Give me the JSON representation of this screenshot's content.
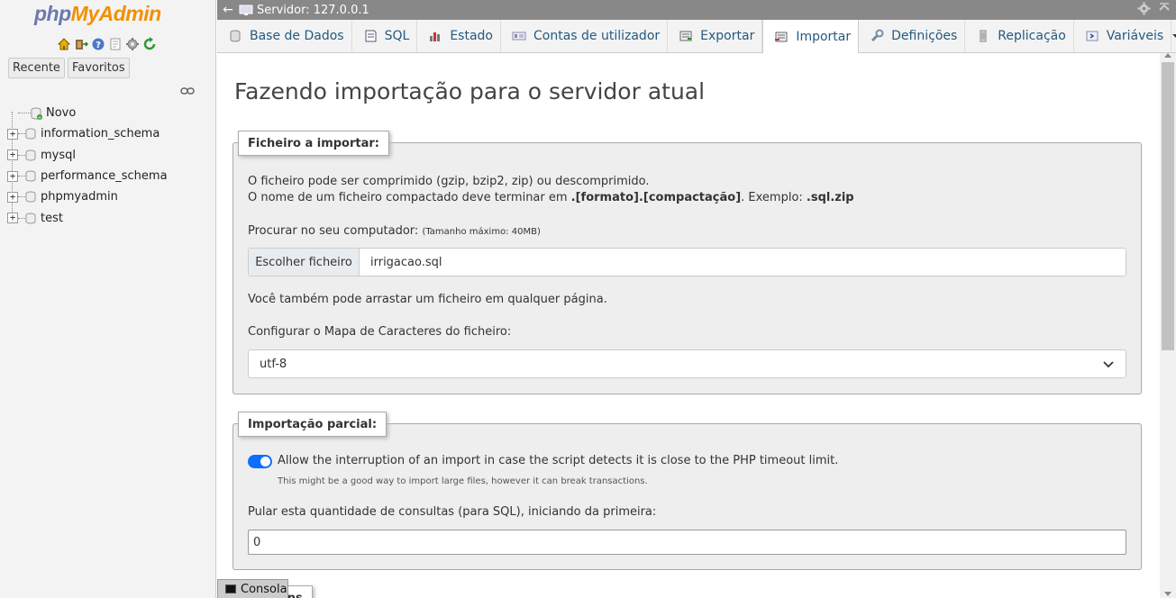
{
  "nav": {
    "logo_php": "php",
    "logo_myadmin": "MyAdmin",
    "quick_icons": [
      "home-icon",
      "exit-icon",
      "help-icon",
      "docs-icon",
      "settings-icon",
      "reload-icon"
    ],
    "tabs": [
      "Recente",
      "Favoritos"
    ],
    "tree": [
      {
        "label": "Novo",
        "icon": "new-database-icon"
      },
      {
        "label": "information_schema",
        "icon": "database-icon"
      },
      {
        "label": "mysql",
        "icon": "database-icon"
      },
      {
        "label": "performance_schema",
        "icon": "database-icon"
      },
      {
        "label": "phpmyadmin",
        "icon": "database-icon"
      },
      {
        "label": "test",
        "icon": "database-icon"
      }
    ]
  },
  "serverbar": {
    "back_arrow": "←",
    "server_label": "Servidor: 127.0.0.1"
  },
  "menu": {
    "tabs": [
      {
        "label": "Base de Dados",
        "icon": "database-icon"
      },
      {
        "label": "SQL",
        "icon": "sql-icon"
      },
      {
        "label": "Estado",
        "icon": "status-icon"
      },
      {
        "label": "Contas de utilizador",
        "icon": "users-icon"
      },
      {
        "label": "Exportar",
        "icon": "export-icon"
      },
      {
        "label": "Importar",
        "icon": "import-icon"
      },
      {
        "label": "Definições",
        "icon": "wrench-icon"
      },
      {
        "label": "Replicação",
        "icon": "replication-icon"
      },
      {
        "label": "Variáveis",
        "icon": "variables-icon"
      }
    ],
    "active": "Importar"
  },
  "main": {
    "title": "Fazendo importação para o servidor atual",
    "file_section": {
      "legend": "Ficheiro a importar:",
      "line1": "O ficheiro pode ser comprimido (gzip, bzip2, zip) ou descomprimido.",
      "line2_pre": "O nome de um ficheiro compactado deve terminar em ",
      "line2_bold": ".[formato].[compactação]",
      "line2_mid": ". Exemplo: ",
      "line2_example": ".sql.zip",
      "browse_label": "Procurar no seu computador:",
      "max_size": "(Tamanho máximo: 40MB)",
      "choose_button": "Escolher ficheiro",
      "file_name": "irrigacao.sql",
      "drag_hint": "Você também pode arrastar um ficheiro em qualquer página.",
      "charset_label": "Configurar o Mapa de Caracteres do ficheiro:",
      "charset_value": "utf-8"
    },
    "partial_section": {
      "legend": "Importação parcial:",
      "interrupt_label": "Allow the interruption of an import in case the script detects it is close to the PHP timeout limit.",
      "interrupt_note": "This might be a good way to import large files, however it can break transactions.",
      "interrupt_enabled": true,
      "skip_label": "Pular esta quantidade de consultas (para SQL), iniciando da primeira:",
      "skip_value": "0"
    },
    "next_legend_partial": "...ptions"
  },
  "console": {
    "label": "Consola"
  },
  "colors": {
    "link": "#235a81",
    "toggle_on": "#0d6efd",
    "serverbar_bg": "#888888"
  }
}
